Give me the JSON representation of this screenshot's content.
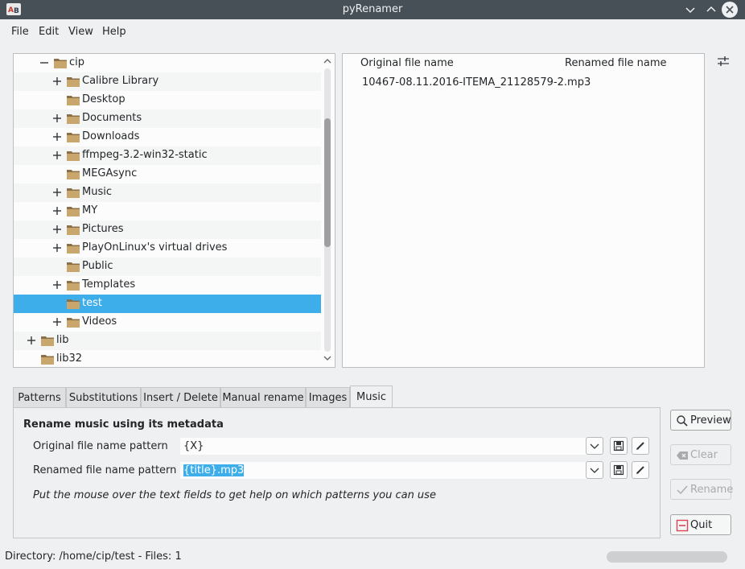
{
  "window": {
    "title": "pyRenamer",
    "app_icon": "pyrenamer-icon",
    "controls": [
      "minimize-icon",
      "maximize-icon",
      "close-icon"
    ]
  },
  "menu": [
    "File",
    "Edit",
    "View",
    "Help"
  ],
  "tree": {
    "items": [
      {
        "label": "cip",
        "expander": "minus"
      },
      {
        "label": "Calibre Library",
        "expander": "plus"
      },
      {
        "label": "Desktop",
        "expander": "none"
      },
      {
        "label": "Documents",
        "expander": "plus"
      },
      {
        "label": "Downloads",
        "expander": "plus"
      },
      {
        "label": "ffmpeg-3.2-win32-static",
        "expander": "plus"
      },
      {
        "label": "MEGAsync",
        "expander": "none"
      },
      {
        "label": "Music",
        "expander": "plus"
      },
      {
        "label": "MY",
        "expander": "plus"
      },
      {
        "label": "Pictures",
        "expander": "plus"
      },
      {
        "label": "PlayOnLinux's virtual drives",
        "expander": "plus"
      },
      {
        "label": "Public",
        "expander": "none"
      },
      {
        "label": "Templates",
        "expander": "plus"
      },
      {
        "label": "test",
        "expander": "none",
        "selected": true
      },
      {
        "label": "Videos",
        "expander": "plus"
      },
      {
        "label": "lib",
        "expander": "plus"
      },
      {
        "label": "lib32",
        "expander": "none"
      }
    ]
  },
  "file_list": {
    "columns": [
      "Original file name",
      "Renamed file name"
    ],
    "rows": [
      {
        "original": "10467-08.11.2016-ITEMA_21128579-2.mp3",
        "renamed": ""
      }
    ]
  },
  "tabs": {
    "labels": [
      "Patterns",
      "Substitutions",
      "Insert / Delete",
      "Manual rename",
      "Images",
      "Music"
    ],
    "active": "Music"
  },
  "music_tab": {
    "heading": "Rename music using its metadata",
    "original_label": "Original file name pattern",
    "original_value": "{X}",
    "renamed_label": "Renamed file name pattern",
    "renamed_value": "{title}.mp3",
    "hint": "Put the mouse over the text fields to get help on which patterns you can use"
  },
  "buttons": {
    "preview": "Preview",
    "clear": "Clear",
    "rename": "Rename",
    "quit": "Quit"
  },
  "status": {
    "text": "Directory: /home/cip/test - Files: 1"
  },
  "colors": {
    "titlebar": "#475057",
    "selection": "#3daee9",
    "window_bg": "#eff0f1",
    "folder": "#c9a66b"
  }
}
